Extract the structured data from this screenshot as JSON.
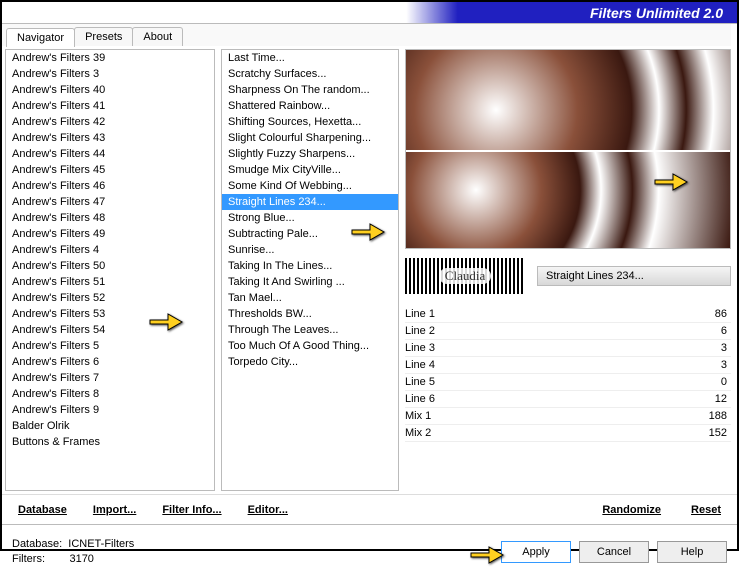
{
  "header": {
    "title": "Filters Unlimited 2.0"
  },
  "tabs": [
    "Navigator",
    "Presets",
    "About"
  ],
  "category_list": [
    "Andrew's Filters 39",
    "Andrew's Filters 3",
    "Andrew's Filters 40",
    "Andrew's Filters 41",
    "Andrew's Filters 42",
    "Andrew's Filters 43",
    "Andrew's Filters 44",
    "Andrew's Filters 45",
    "Andrew's Filters 46",
    "Andrew's Filters 47",
    "Andrew's Filters 48",
    "Andrew's Filters 49",
    "Andrew's Filters 4",
    "Andrew's Filters 50",
    "Andrew's Filters 51",
    "Andrew's Filters 52",
    "Andrew's Filters 53",
    "Andrew's Filters 54",
    "Andrew's Filters 5",
    "Andrew's Filters 6",
    "Andrew's Filters 7",
    "Andrew's Filters 8",
    "Andrew's Filters 9",
    "Balder Olrik",
    "Buttons & Frames"
  ],
  "category_selected_index": 14,
  "filter_list": [
    "Last Time...",
    "Scratchy Surfaces...",
    "Sharpness On The random...",
    "Shattered Rainbow...",
    "Shifting Sources, Hexetta...",
    "Slight Colourful Sharpening...",
    "Slightly Fuzzy Sharpens...",
    "Smudge Mix CityVille...",
    "Some Kind Of Webbing...",
    "Straight Lines 234...",
    "Strong Blue...",
    "Subtracting Pale...",
    "Sunrise...",
    "Taking In The Lines...",
    "Taking It And Swirling ...",
    "Tan Mael...",
    "Thresholds BW...",
    "Through The Leaves...",
    "Too Much Of A Good Thing...",
    "Torpedo City..."
  ],
  "filter_selected_index": 9,
  "logo_text": "Claudia",
  "current_filter_name": "Straight Lines 234...",
  "params": [
    {
      "label": "Line 1",
      "value": 86
    },
    {
      "label": "Line 2",
      "value": 6
    },
    {
      "label": "Line 3",
      "value": 3
    },
    {
      "label": "Line 4",
      "value": 3
    },
    {
      "label": "Line 5",
      "value": 0
    },
    {
      "label": "Line 6",
      "value": 12
    },
    {
      "label": "Mix 1",
      "value": 188
    },
    {
      "label": "Mix 2",
      "value": 152
    }
  ],
  "left_links": {
    "database": "Database",
    "import": "Import...",
    "filter_info": "Filter Info...",
    "editor": "Editor..."
  },
  "right_links": {
    "randomize": "Randomize",
    "reset": "Reset"
  },
  "footer": {
    "db_label": "Database:",
    "db_value": "ICNET-Filters",
    "filters_label": "Filters:",
    "filters_value": "3170",
    "apply": "Apply",
    "cancel": "Cancel",
    "help": "Help"
  }
}
